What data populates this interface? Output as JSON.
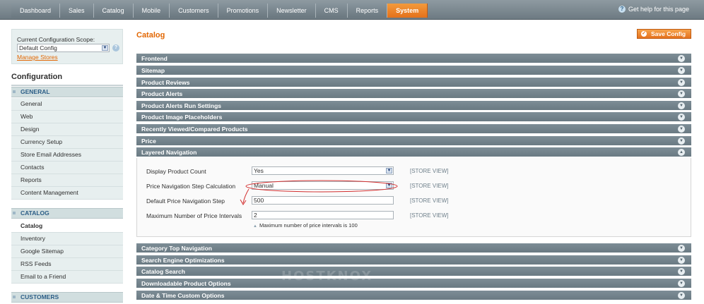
{
  "topnav": {
    "items": [
      "Dashboard",
      "Sales",
      "Catalog",
      "Mobile",
      "Customers",
      "Promotions",
      "Newsletter",
      "CMS",
      "Reports",
      "System"
    ],
    "active": "System",
    "help": "Get help for this page"
  },
  "scope": {
    "label": "Current Configuration Scope:",
    "value": "Default Config",
    "manage": "Manage Stores"
  },
  "sidebar": {
    "heading": "Configuration",
    "group_general": "GENERAL",
    "general_items": [
      "General",
      "Web",
      "Design",
      "Currency Setup",
      "Store Email Addresses",
      "Contacts",
      "Reports",
      "Content Management"
    ],
    "group_catalog": "CATALOG",
    "catalog_items": [
      "Catalog",
      "Inventory",
      "Google Sitemap",
      "RSS Feeds",
      "Email to a Friend"
    ],
    "group_customers": "CUSTOMERS"
  },
  "main": {
    "title": "Catalog",
    "save": "Save Config",
    "sections_top": [
      "Frontend",
      "Sitemap",
      "Product Reviews",
      "Product Alerts",
      "Product Alerts Run Settings",
      "Product Image Placeholders",
      "Recently Viewed/Compared Products",
      "Price"
    ],
    "open_section": "Layered Navigation",
    "fields": {
      "display_count_label": "Display Product Count",
      "display_count_value": "Yes",
      "step_calc_label": "Price Navigation Step Calculation",
      "step_calc_value": "Manual",
      "default_step_label": "Default Price Navigation Step",
      "default_step_value": "500",
      "max_intervals_label": "Maximum Number of Price Intervals",
      "max_intervals_value": "2",
      "max_intervals_hint": "Maximum number of price intervals is 100",
      "scope_tag": "[STORE VIEW]"
    },
    "sections_bottom": [
      "Category Top Navigation",
      "Search Engine Optimizations",
      "Catalog Search",
      "Downloadable Product Options",
      "Date & Time Custom Options"
    ]
  },
  "watermark": "HOSTKNOX",
  "colors": {
    "accent": "#e26703",
    "section_bar": "#74848d",
    "sidebar_bg": "#e7efef",
    "annotation": "#d32f2f"
  }
}
